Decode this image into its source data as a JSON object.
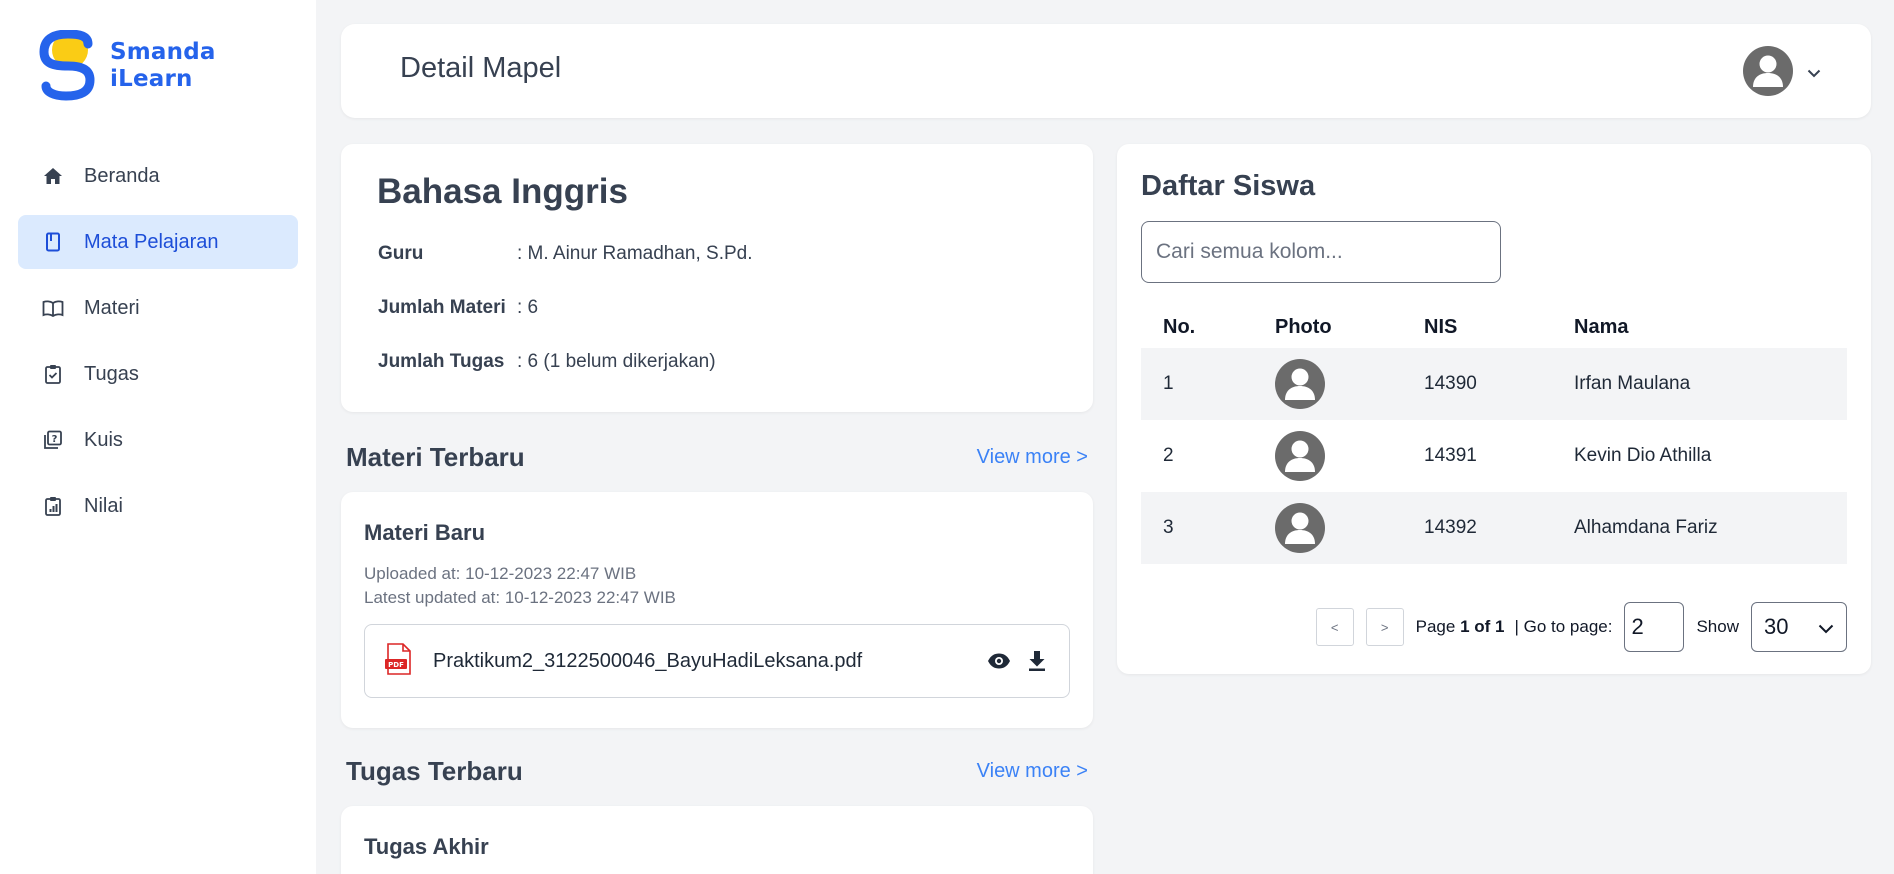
{
  "app": {
    "logo_line1": "Smanda",
    "logo_line2": "iLearn",
    "brand_color": "#2563eb",
    "accent_yellow": "#facc15"
  },
  "sidebar": {
    "items": [
      {
        "label": "Beranda",
        "icon": "home-icon",
        "active": false
      },
      {
        "label": "Mata Pelajaran",
        "icon": "book-icon",
        "active": true
      },
      {
        "label": "Materi",
        "icon": "open-book-icon",
        "active": false
      },
      {
        "label": "Tugas",
        "icon": "clipboard-check-icon",
        "active": false
      },
      {
        "label": "Kuis",
        "icon": "quiz-icon",
        "active": false
      },
      {
        "label": "Nilai",
        "icon": "report-icon",
        "active": false
      }
    ]
  },
  "header": {
    "title": "Detail Mapel"
  },
  "subject": {
    "title": "Bahasa Inggris",
    "guru_label": "Guru",
    "guru_value": ": M. Ainur Ramadhan, S.Pd.",
    "materi_label": "Jumlah Materi",
    "materi_value": ": 6",
    "tugas_label": "Jumlah Tugas",
    "tugas_value": ": 6 (1 belum dikerjakan)"
  },
  "materi_section": {
    "heading": "Materi Terbaru",
    "view_more": "View more >",
    "card": {
      "title": "Materi Baru",
      "uploaded": "Uploaded at: 10-12-2023 22:47 WIB",
      "updated": "Latest updated at: 10-12-2023 22:47 WIB",
      "file_name": "Praktikum2_3122500046_BayuHadiLeksana.pdf",
      "file_badge": "PDF"
    }
  },
  "tugas_section": {
    "heading": "Tugas Terbaru",
    "view_more": "View more >",
    "card": {
      "title": "Tugas Akhir"
    }
  },
  "siswa": {
    "title": "Daftar Siswa",
    "search_placeholder": "Cari semua kolom...",
    "columns": [
      "No.",
      "Photo",
      "NIS",
      "Nama"
    ],
    "rows": [
      {
        "no": "1",
        "nis": "14390",
        "nama": "Irfan Maulana"
      },
      {
        "no": "2",
        "nis": "14391",
        "nama": "Kevin Dio Athilla"
      },
      {
        "no": "3",
        "nis": "14392",
        "nama": "Alhamdana Fariz"
      }
    ],
    "pager": {
      "prev": "<",
      "next": ">",
      "page_prefix": "Page ",
      "page_value": "1 of 1",
      "goto_label": "| Go to page:",
      "goto_value": "2",
      "show_label": "Show",
      "show_value": "30"
    }
  }
}
